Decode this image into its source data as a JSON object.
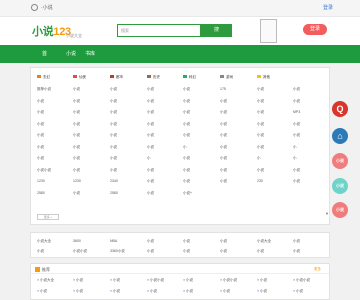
{
  "topbar": {
    "left_text": "·小说",
    "right_text": "登录"
  },
  "header": {
    "logo_main": "小说",
    "logo_num": "123",
    "logo_sub": "小说大全",
    "search_placeholder": "搜索",
    "search_button": "搜",
    "login_button": "登录"
  },
  "nav": {
    "items": [
      "首",
      "小说",
      "书库"
    ]
  },
  "categories": {
    "headers": [
      "玄幻",
      "仙侠",
      "都市",
      "历史",
      "科幻",
      "游戏",
      "其他"
    ],
    "rows": [
      [
        "推荐小说",
        "小说",
        "小说",
        "小说",
        "小说",
        "175",
        "小说",
        "小说"
      ],
      [
        "小说",
        "小说",
        "小说",
        "小说",
        "小说",
        "小说",
        "小说",
        "小说"
      ],
      [
        "小说",
        "小说",
        "小说",
        "小说",
        "小说",
        "小说",
        "小说",
        "MP3"
      ],
      [
        "小说",
        "小说",
        "小说",
        "小说",
        "小说",
        "小说",
        "小说",
        "小说"
      ],
      [
        "小说",
        "小说",
        "小说",
        "小说",
        "小说",
        "小说",
        "小说",
        "小说"
      ],
      [
        "小说",
        "小说",
        "小说",
        "小说",
        "小",
        "小说",
        "小说",
        "小"
      ],
      [
        "小说",
        "小说",
        "小说",
        "小",
        "小说",
        "小说",
        "小",
        "小"
      ],
      [
        "小说小说",
        "小说",
        "小说",
        "小说",
        "小说",
        "小说",
        "小说",
        "小说"
      ],
      [
        "1230",
        "1230",
        "2340",
        "小说",
        "小说",
        "小说",
        "230",
        "小说"
      ],
      [
        "2580",
        "小说",
        "2580",
        "小说",
        "小说+",
        "",
        "",
        ""
      ]
    ],
    "more": "更多 +"
  },
  "links": [
    "小说大全",
    "3600",
    "NBA",
    "小说",
    "小说",
    "小说",
    "小说大全",
    "小说",
    "小说",
    "小说小说",
    "3360小说",
    "小说",
    "小说",
    "小说",
    "小说",
    "小说"
  ],
  "recommend": {
    "title": "推荐",
    "more": "更多",
    "items": [
      "小说大全",
      "小说",
      "小说",
      "小说小说",
      "小说",
      "小说小说",
      "小说",
      "小说小说",
      "小说",
      "小说",
      "小说",
      "小说",
      "小说",
      "小说",
      "小说",
      "小说"
    ]
  },
  "float_buttons": [
    {
      "label": "Q",
      "color": "#d9352b"
    },
    {
      "label": "⌂",
      "color": "#2d7ab8"
    },
    {
      "label": "小说",
      "color": "#f07d7d"
    },
    {
      "label": "小说",
      "color": "#6fd3c9"
    },
    {
      "label": "小说",
      "color": "#f07d7d"
    }
  ]
}
